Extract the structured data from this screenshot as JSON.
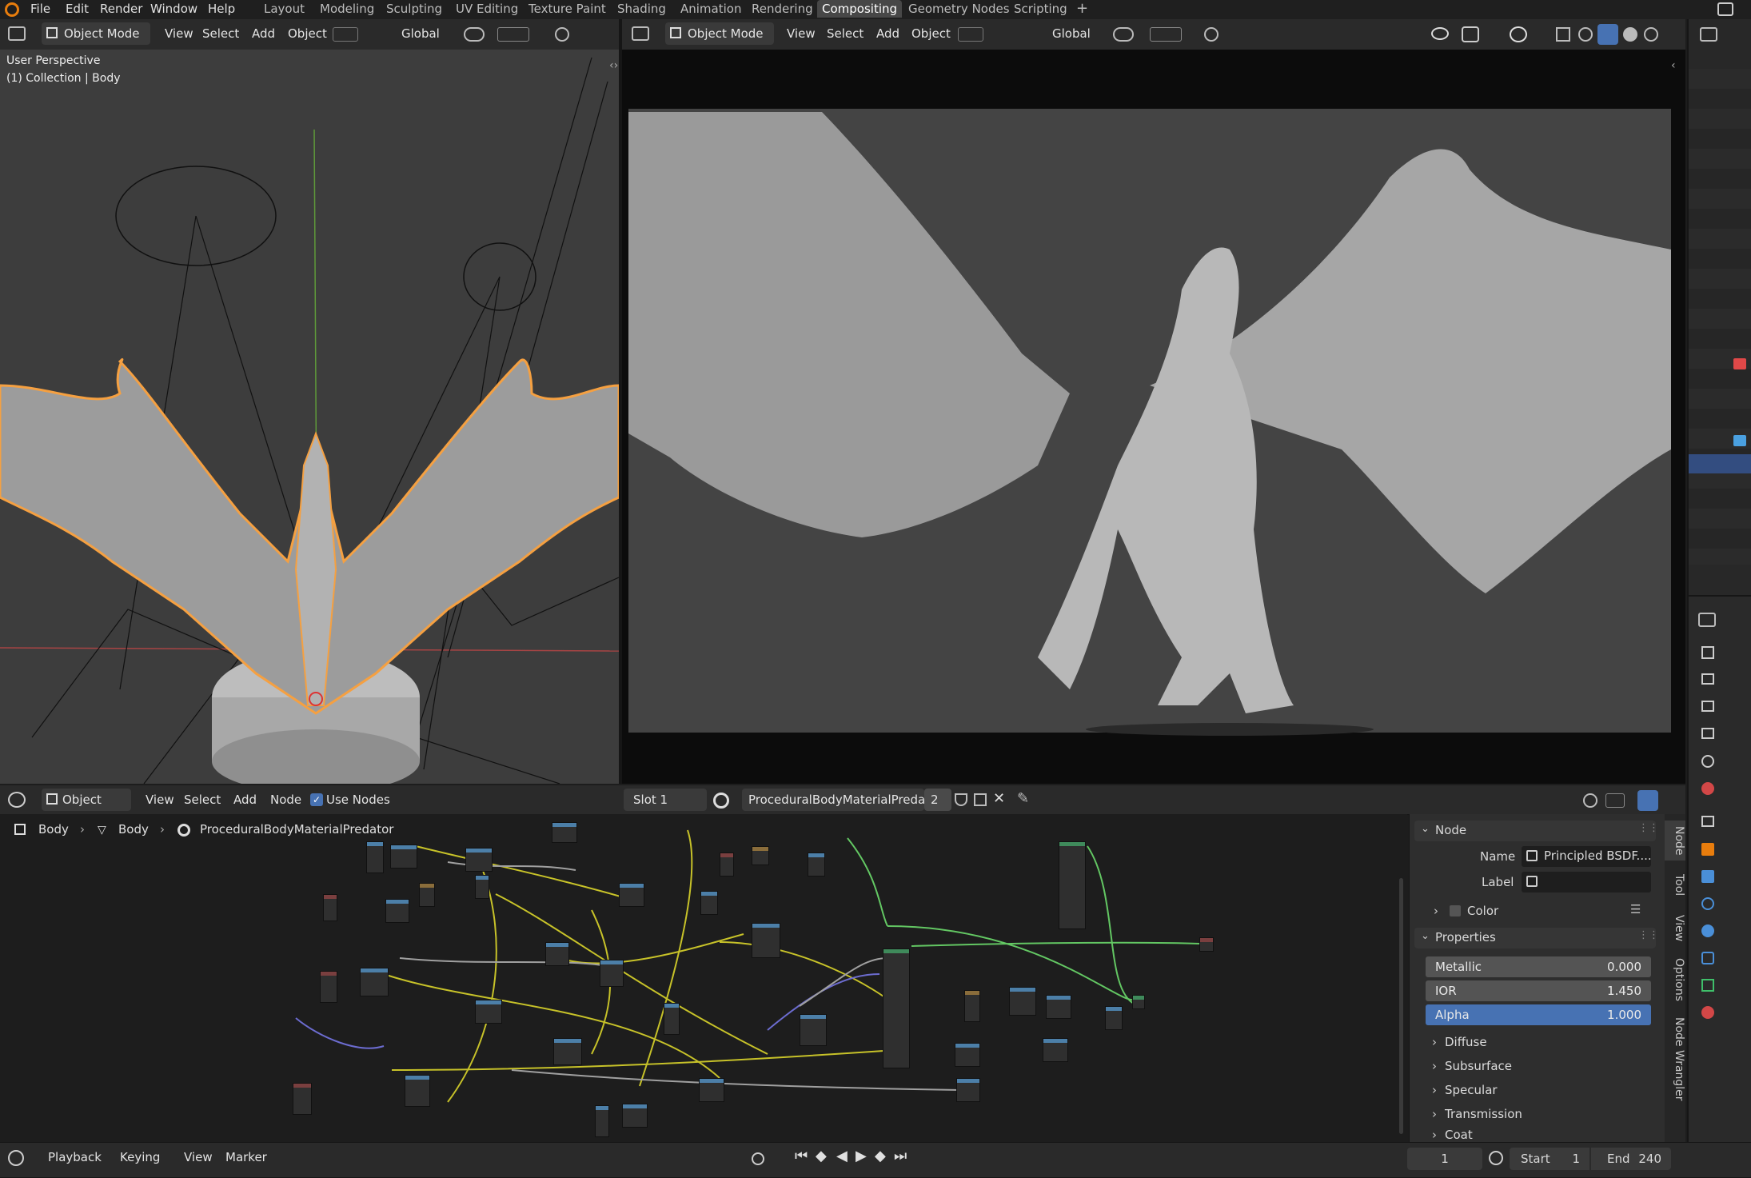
{
  "top_menu": {
    "items": [
      "File",
      "Edit",
      "Render",
      "Window",
      "Help"
    ],
    "workspaces": [
      "Layout",
      "Modeling",
      "Sculpting",
      "UV Editing",
      "Texture Paint",
      "Shading",
      "Animation",
      "Rendering",
      "Compositing",
      "Geometry Nodes",
      "Scripting"
    ],
    "active_workspace": "Compositing",
    "add_tab_symbol": "+"
  },
  "viewport_left": {
    "mode": "Object Mode",
    "menus": [
      "View",
      "Select",
      "Add",
      "Object"
    ],
    "transform_orientation": "Global",
    "overlay_text": "User Perspective",
    "collection_text": "(1) Collection | Body"
  },
  "viewport_right": {
    "mode": "Object Mode",
    "menus": [
      "View",
      "Select",
      "Add",
      "Object"
    ],
    "transform_orientation": "Global"
  },
  "node_editor": {
    "editor_type": "Object",
    "menus": [
      "View",
      "Select",
      "Add",
      "Node"
    ],
    "use_nodes_label": "Use Nodes",
    "slot": "Slot 1",
    "material_name": "ProceduralBodyMaterialPredator",
    "user_count": "2",
    "breadcrumb": [
      "Body",
      "Body",
      "ProceduralBodyMaterialPredator"
    ]
  },
  "node_panel": {
    "section_node": "Node",
    "name_label": "Name",
    "name_value": "Principled BSDF....",
    "label_label": "Label",
    "label_value": "",
    "color_label": "Color",
    "section_properties": "Properties",
    "properties": [
      {
        "label": "Metallic",
        "value": "0.000"
      },
      {
        "label": "IOR",
        "value": "1.450"
      },
      {
        "label": "Alpha",
        "value": "1.000"
      }
    ],
    "subsections": [
      "Diffuse",
      "Subsurface",
      "Specular",
      "Transmission",
      "Coat"
    ],
    "side_tabs": [
      "Node",
      "Tool",
      "View",
      "Options",
      "Node Wrangler"
    ]
  },
  "timeline": {
    "menus": [
      "Playback",
      "Keying",
      "View",
      "Marker"
    ],
    "current_frame": "1",
    "start_label": "Start",
    "start_value": "1",
    "end_label": "End",
    "end_value": "240"
  },
  "colors": {
    "accent_blue": "#4772b3",
    "selection_orange": "#f5a041",
    "wire_yellow": "#c7c229",
    "wire_green": "#63c763",
    "wire_purple": "#6c6cd0",
    "wire_grey": "#a0a0a0"
  }
}
